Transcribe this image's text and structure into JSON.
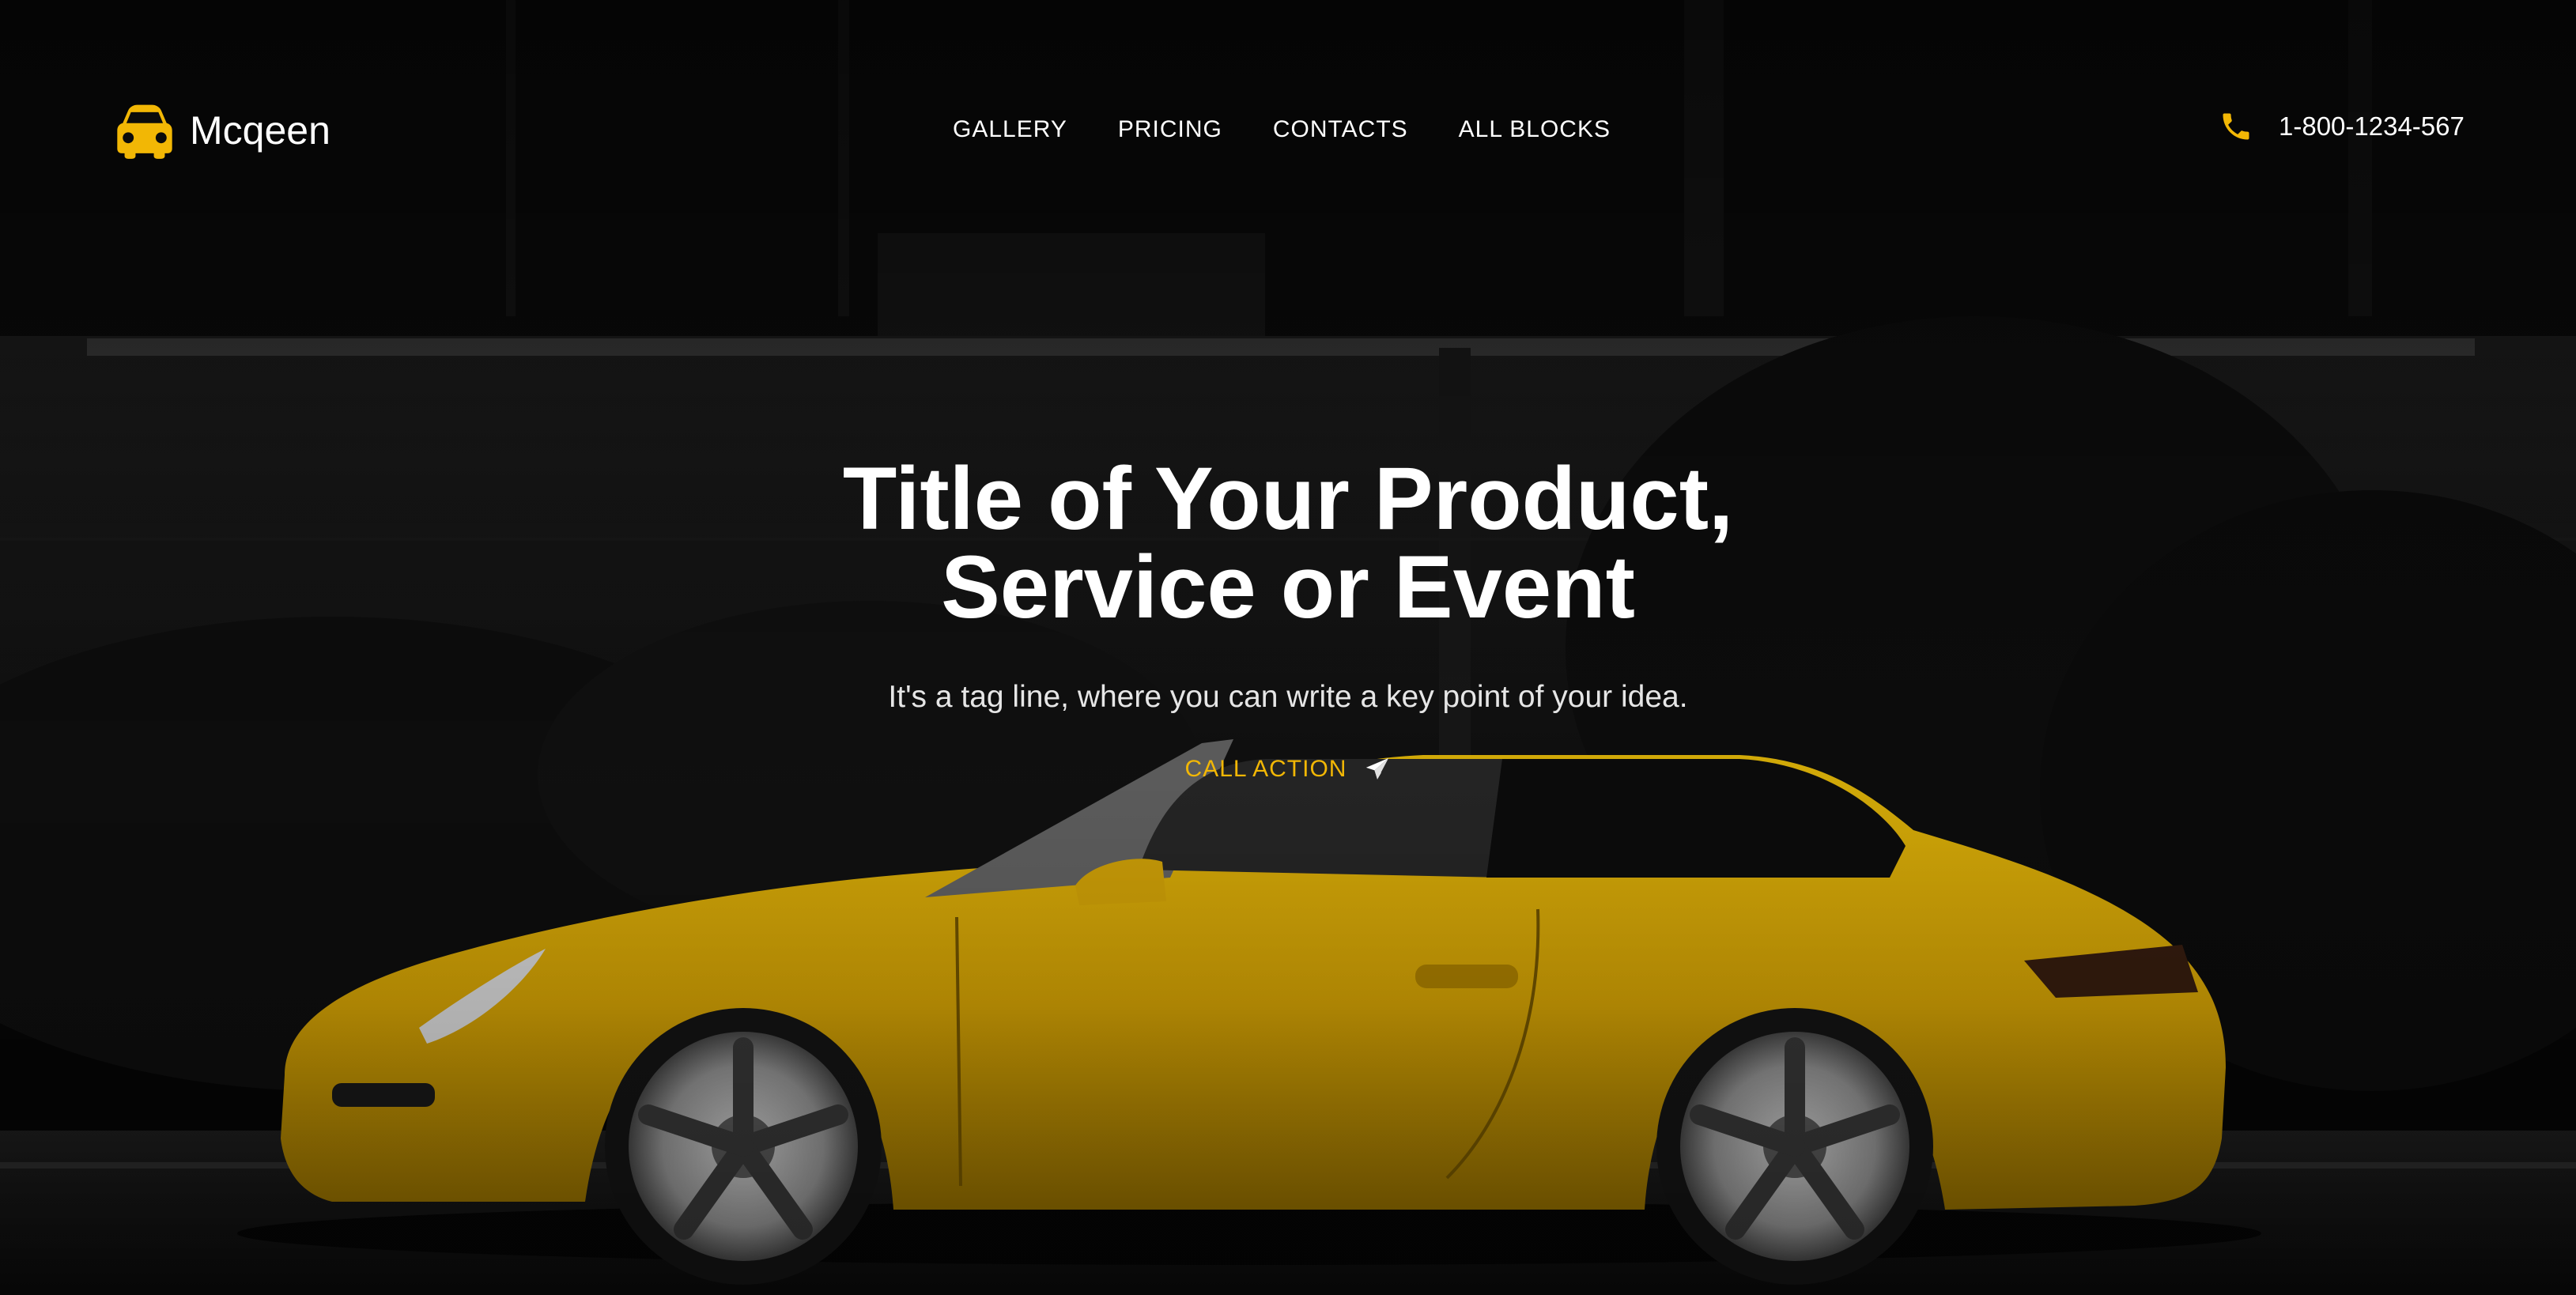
{
  "brand": {
    "name": "Mcqeen",
    "icon": "car-icon"
  },
  "nav": {
    "items": [
      {
        "label": "GALLERY"
      },
      {
        "label": "PRICING"
      },
      {
        "label": "CONTACTS"
      },
      {
        "label": "ALL BLOCKS"
      }
    ]
  },
  "contact": {
    "phone": "1-800-1234-567",
    "icon": "phone-icon"
  },
  "hero": {
    "title_line1": "Title of Your Product,",
    "title_line2": "Service or Event",
    "tagline": "It's a tag line, where you can write a key point of your idea.",
    "cta_label": "CALL ACTION",
    "cta_icon": "paper-plane-icon"
  },
  "colors": {
    "accent": "#f2b705",
    "car_yellow": "#e8b50b",
    "background": "#060606",
    "text": "#ffffff"
  }
}
